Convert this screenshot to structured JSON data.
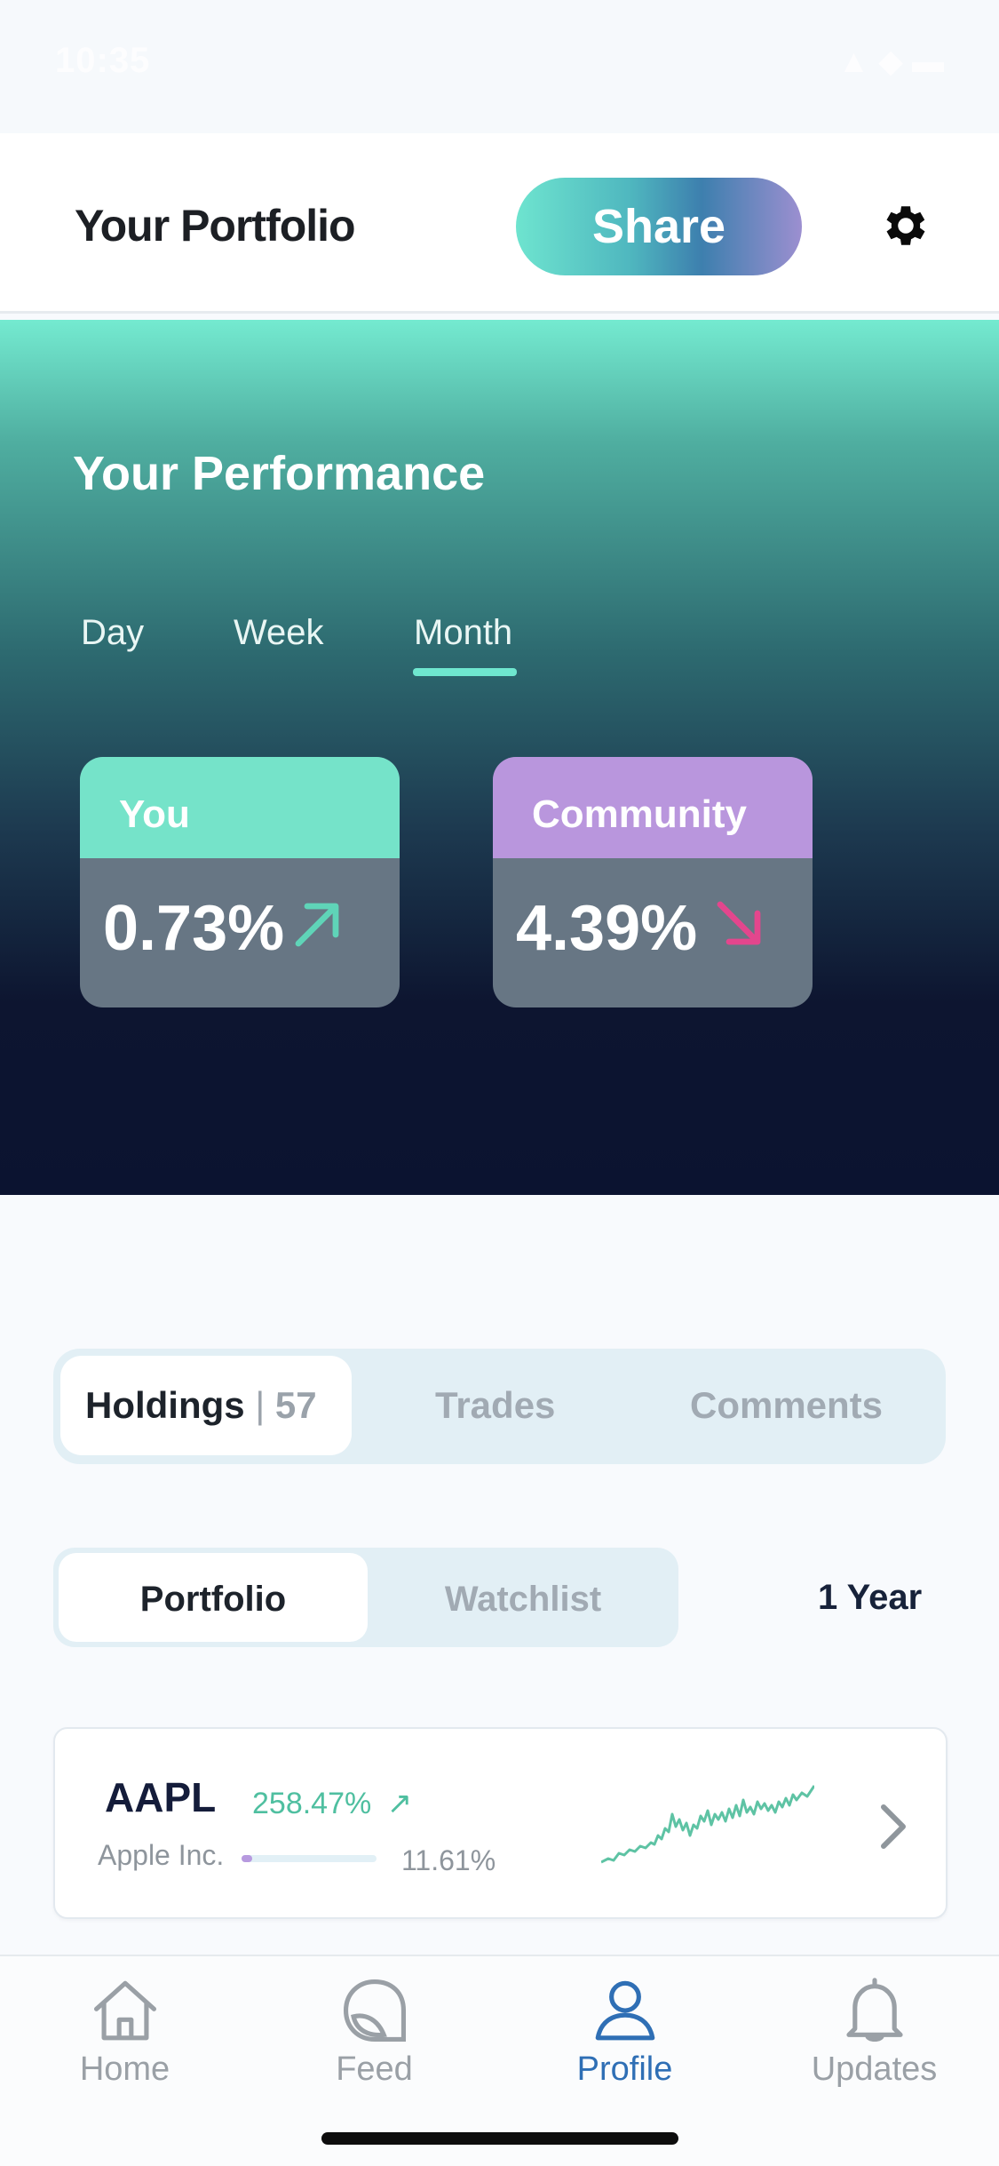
{
  "status": {
    "time": "10:35",
    "icons": "▲ ◆ ▬"
  },
  "header": {
    "title": "Your Portfolio",
    "share_label": "Share"
  },
  "performance": {
    "title": "Your Performance",
    "tabs": [
      "Day",
      "Week",
      "Month"
    ],
    "active_tab": "Month",
    "you": {
      "label": "You",
      "value": "0.73%",
      "trend": "up"
    },
    "community": {
      "label": "Community",
      "value": "4.39%",
      "trend": "down"
    }
  },
  "main_tabs": {
    "holdings_label": "Holdings",
    "holdings_count": "57",
    "trades_label": "Trades",
    "comments_label": "Comments",
    "active": "Holdings"
  },
  "sub_tabs": {
    "portfolio_label": "Portfolio",
    "watchlist_label": "Watchlist",
    "active": "Portfolio",
    "range": "1 Year"
  },
  "holdings": [
    {
      "ticker": "AAPL",
      "change": "258.47%",
      "trend": "up",
      "company": "Apple Inc.",
      "weight": "11.61%",
      "weight_fraction": 0.08
    }
  ],
  "tabbar": {
    "items": [
      {
        "label": "Home",
        "icon": "home-icon"
      },
      {
        "label": "Feed",
        "icon": "feed-icon"
      },
      {
        "label": "Profile",
        "icon": "profile-icon"
      },
      {
        "label": "Updates",
        "icon": "bell-icon"
      }
    ],
    "active": "Profile"
  },
  "colors": {
    "accent": "#6fe7cf",
    "community": "#b996dd",
    "up": "#5fd4b8",
    "down": "#e3468d",
    "active_tab": "#2f6fb5"
  }
}
